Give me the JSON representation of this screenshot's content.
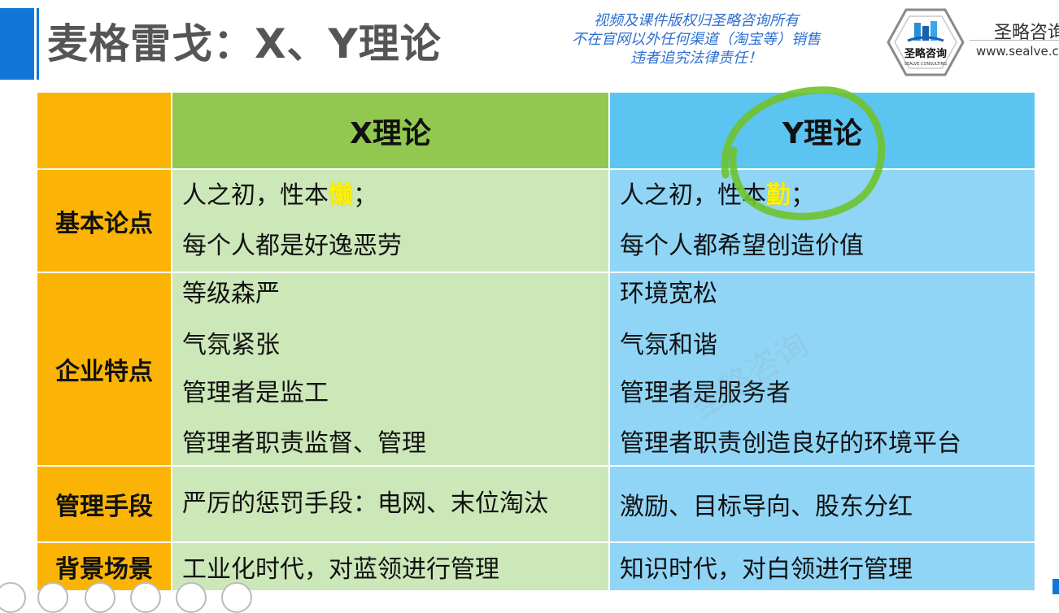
{
  "header": {
    "title": "麦格雷戈：X、Y理论",
    "copyright_lines": [
      "视频及课件版权归圣略咨询所有",
      "不在官网以外任何渠道（淘宝等）销售",
      "违者追究法律责任！"
    ],
    "logo_text": "圣略咨询",
    "logo_subtext": "SEALVE CONSULTING",
    "brand_name": "圣略咨询",
    "brand_url": "www.sealve.c"
  },
  "table": {
    "col_x": "X理论",
    "col_y": "Y理论",
    "rows": [
      {
        "label": "基本论点",
        "x": [
          {
            "pre": "人之初，性本",
            "hl": "懒",
            "post": "；"
          },
          {
            "pre": "每个人都是好逸恶劳",
            "hl": "",
            "post": ""
          }
        ],
        "y": [
          {
            "pre": "人之初，性本",
            "hl": "勤",
            "post": "；"
          },
          {
            "pre": "每个人都希望创造价值",
            "hl": "",
            "post": ""
          }
        ]
      },
      {
        "label": "企业特点",
        "x": [
          "等级森严",
          "气氛紧张",
          "管理者是监工",
          "管理者职责监督、管理"
        ],
        "y": [
          "环境宽松",
          "气氛和谐",
          "管理者是服务者",
          "管理者职责创造良好的环境平台"
        ]
      },
      {
        "label": "管理手段",
        "x": [
          "严厉的惩罚手段：电网、末位淘汰"
        ],
        "y": [
          "激励、目标导向、股东分红"
        ]
      },
      {
        "label": "背景场景",
        "x": [
          "工业化时代，对蓝领进行管理"
        ],
        "y": [
          "知识时代，对白领进行管理"
        ]
      }
    ]
  },
  "watermark": "圣略咨询",
  "colors": {
    "accent_blue": "#1177d6",
    "label_orange": "#fbb405",
    "x_header_green": "#92c84f",
    "x_body_green": "#cce7b8",
    "y_header_blue": "#5cc4f1",
    "y_body_blue": "#90d5f6",
    "highlight_yellow": "#fff200",
    "circle_green": "#6fc32c"
  }
}
